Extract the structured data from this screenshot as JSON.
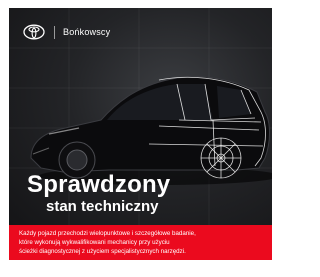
{
  "header": {
    "brand_name": "Bońkowscy",
    "logo_icon": "toyota-logo-icon"
  },
  "headline": {
    "line1": "Sprawdzony",
    "line2": "stan techniczny"
  },
  "body": {
    "lines": [
      "Każdy pojazd przechodzi wielopunktowe i szczegółowe badanie,",
      "które wykonują wykwalifikowani mechanicy przy użyciu",
      "ścieżki diagnostycznej z użyciem specjalistycznych narzędzi."
    ]
  },
  "colors": {
    "accent_red": "#eb0a1e",
    "dark_background": "#1c1d20",
    "text": "#ffffff"
  }
}
